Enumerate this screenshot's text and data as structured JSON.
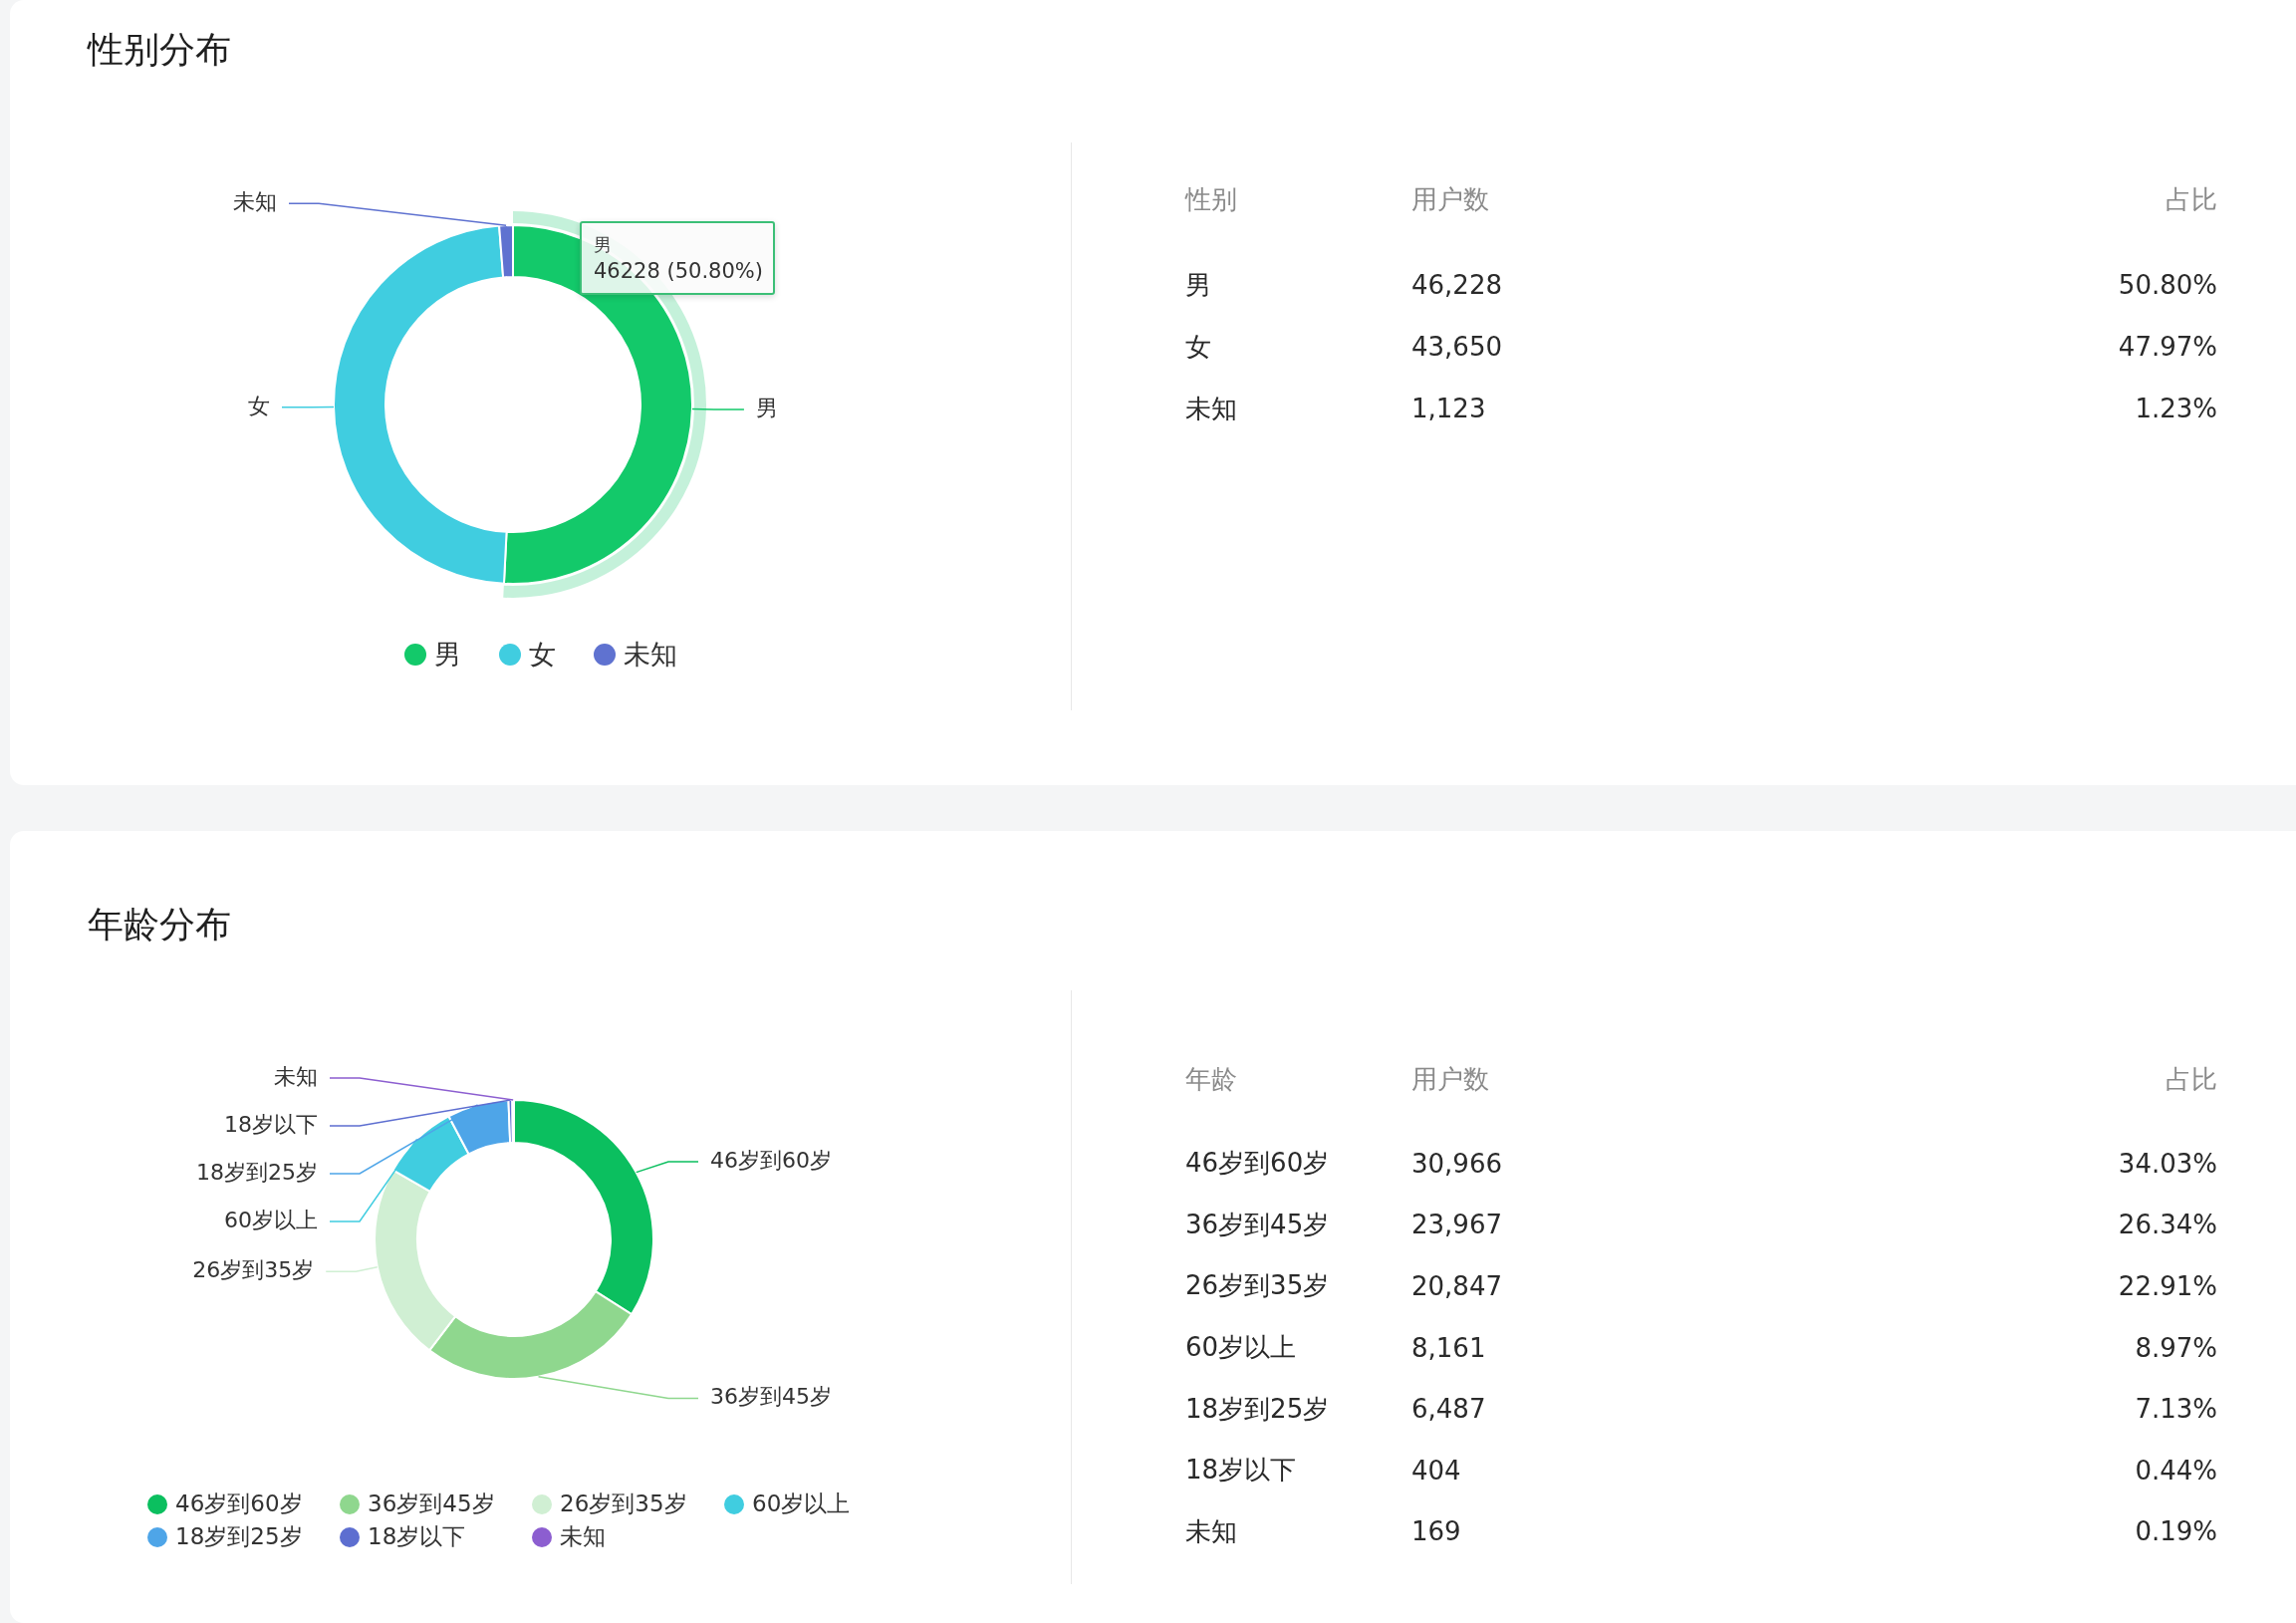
{
  "gender": {
    "title": "性别分布",
    "chart_data": {
      "type": "donut",
      "categories": [
        "男",
        "女",
        "未知"
      ],
      "series": [
        {
          "values": [
            50.8,
            47.97,
            1.23
          ]
        }
      ],
      "colors": [
        "#13c96a",
        "#40cde0",
        "#5f72d0"
      ]
    },
    "emphasis": [
      true,
      false,
      false
    ],
    "tooltip": {
      "title": "男",
      "text": "46228 (50.80%)"
    },
    "legend": [
      "男",
      "女",
      "未知"
    ],
    "table": {
      "columns": [
        "性别",
        "用户数",
        "占比"
      ],
      "rows": [
        [
          "男",
          "46,228",
          "50.80%"
        ],
        [
          "女",
          "43,650",
          "47.97%"
        ],
        [
          "未知",
          "1,123",
          "1.23%"
        ]
      ]
    }
  },
  "age": {
    "title": "年龄分布",
    "chart_data": {
      "type": "donut",
      "categories": [
        "46岁到60岁",
        "36岁到45岁",
        "26岁到35岁",
        "60岁以上",
        "18岁到25岁",
        "18岁以下",
        "未知"
      ],
      "series": [
        {
          "values": [
            34.03,
            26.34,
            22.91,
            8.97,
            7.13,
            0.44,
            0.19
          ]
        }
      ],
      "colors": [
        "#0bbf5f",
        "#8fd78e",
        "#d0efd3",
        "#40cde0",
        "#4ea5e8",
        "#5d6ed0",
        "#8c5ed0"
      ]
    },
    "legend": [
      "46岁到60岁",
      "36岁到45岁",
      "26岁到35岁",
      "60岁以上",
      "18岁到25岁",
      "18岁以下",
      "未知"
    ],
    "table": {
      "columns": [
        "年龄",
        "用户数",
        "占比"
      ],
      "rows": [
        [
          "46岁到60岁",
          "30,966",
          "34.03%"
        ],
        [
          "36岁到45岁",
          "23,967",
          "26.34%"
        ],
        [
          "26岁到35岁",
          "20,847",
          "22.91%"
        ],
        [
          "60岁以上",
          "8,161",
          "8.97%"
        ],
        [
          "18岁到25岁",
          "6,487",
          "7.13%"
        ],
        [
          "18岁以下",
          "404",
          "0.44%"
        ],
        [
          "未知",
          "169",
          "0.19%"
        ]
      ]
    }
  }
}
